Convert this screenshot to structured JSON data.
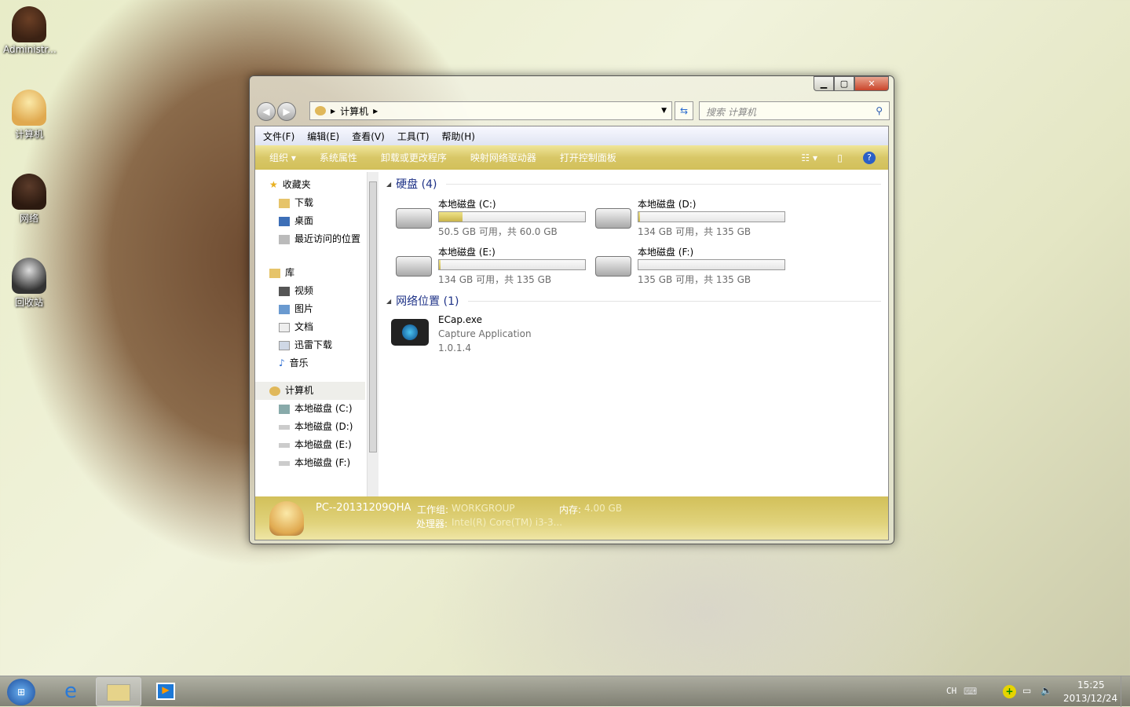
{
  "desktop": {
    "icons": [
      {
        "label": "Administr..."
      },
      {
        "label": "计算机"
      },
      {
        "label": "网络"
      },
      {
        "label": "回收站"
      }
    ]
  },
  "window": {
    "address": {
      "path": "计算机"
    },
    "search": {
      "placeholder": "搜索 计算机"
    },
    "menu": [
      "文件(F)",
      "编辑(E)",
      "查看(V)",
      "工具(T)",
      "帮助(H)"
    ],
    "toolbar": [
      "组织 ▾",
      "系统属性",
      "卸载或更改程序",
      "映射网络驱动器",
      "打开控制面板"
    ],
    "nav": {
      "favorites": {
        "label": "收藏夹",
        "items": [
          "下载",
          "桌面",
          "最近访问的位置"
        ]
      },
      "libraries": {
        "label": "库",
        "items": [
          "视频",
          "图片",
          "文档",
          "迅雷下载",
          "音乐"
        ]
      },
      "computer": {
        "label": "计算机",
        "items": [
          "本地磁盘 (C:)",
          "本地磁盘 (D:)",
          "本地磁盘 (E:)",
          "本地磁盘 (F:)"
        ]
      }
    },
    "groups": {
      "hdd": "硬盘 (4)",
      "network": "网络位置 (1)"
    },
    "drives": [
      {
        "name": "本地磁盘 (C:)",
        "space": "50.5 GB 可用，共 60.0 GB",
        "used_pct": 16
      },
      {
        "name": "本地磁盘 (D:)",
        "space": "134 GB 可用，共 135 GB",
        "used_pct": 1
      },
      {
        "name": "本地磁盘 (E:)",
        "space": "134 GB 可用，共 135 GB",
        "used_pct": 1
      },
      {
        "name": "本地磁盘 (F:)",
        "space": "135 GB 可用，共 135 GB",
        "used_pct": 0
      }
    ],
    "network_item": {
      "name": "ECap.exe",
      "desc": "Capture Application",
      "version": "1.0.1.4"
    },
    "details": {
      "pc": "PC--20131209QHA",
      "workgroup_label": "工作组:",
      "workgroup": "WORKGROUP",
      "memory_label": "内存:",
      "memory": "4.00 GB",
      "cpu_label": "处理器:",
      "cpu": "Intel(R) Core(TM) i3-3..."
    }
  },
  "taskbar": {
    "lang": "CH",
    "time": "15:25",
    "date": "2013/12/24"
  }
}
